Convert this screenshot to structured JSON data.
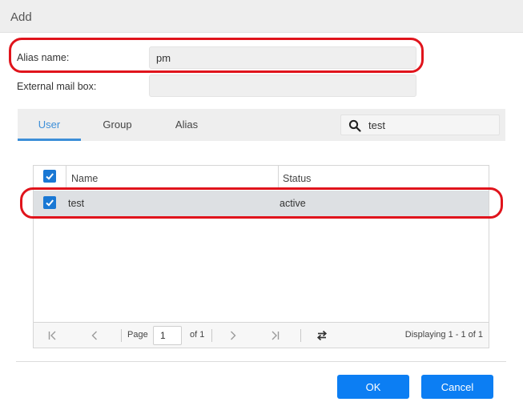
{
  "dialog": {
    "title": "Add"
  },
  "form": {
    "alias_label": "Alias name:",
    "alias_value": "pm",
    "external_label": "External mail box:",
    "external_value": ""
  },
  "tabs": [
    {
      "label": "User",
      "active": true
    },
    {
      "label": "Group",
      "active": false
    },
    {
      "label": "Alias",
      "active": false
    }
  ],
  "search": {
    "value": "test",
    "icon": "search-icon"
  },
  "grid": {
    "columns": [
      "Name",
      "Status"
    ],
    "rows": [
      {
        "name": "test",
        "status": "active",
        "checked": true
      }
    ],
    "select_all_checked": true
  },
  "pager": {
    "page_label": "Page",
    "page_value": "1",
    "of_label": "of 1",
    "displaying": "Displaying 1 - 1 of 1"
  },
  "buttons": {
    "ok": "OK",
    "cancel": "Cancel"
  },
  "colors": {
    "accent": "#0c7ef3",
    "tab_active": "#3d8fd8",
    "highlight": "#e0141c",
    "row_selected": "#dde0e3"
  }
}
